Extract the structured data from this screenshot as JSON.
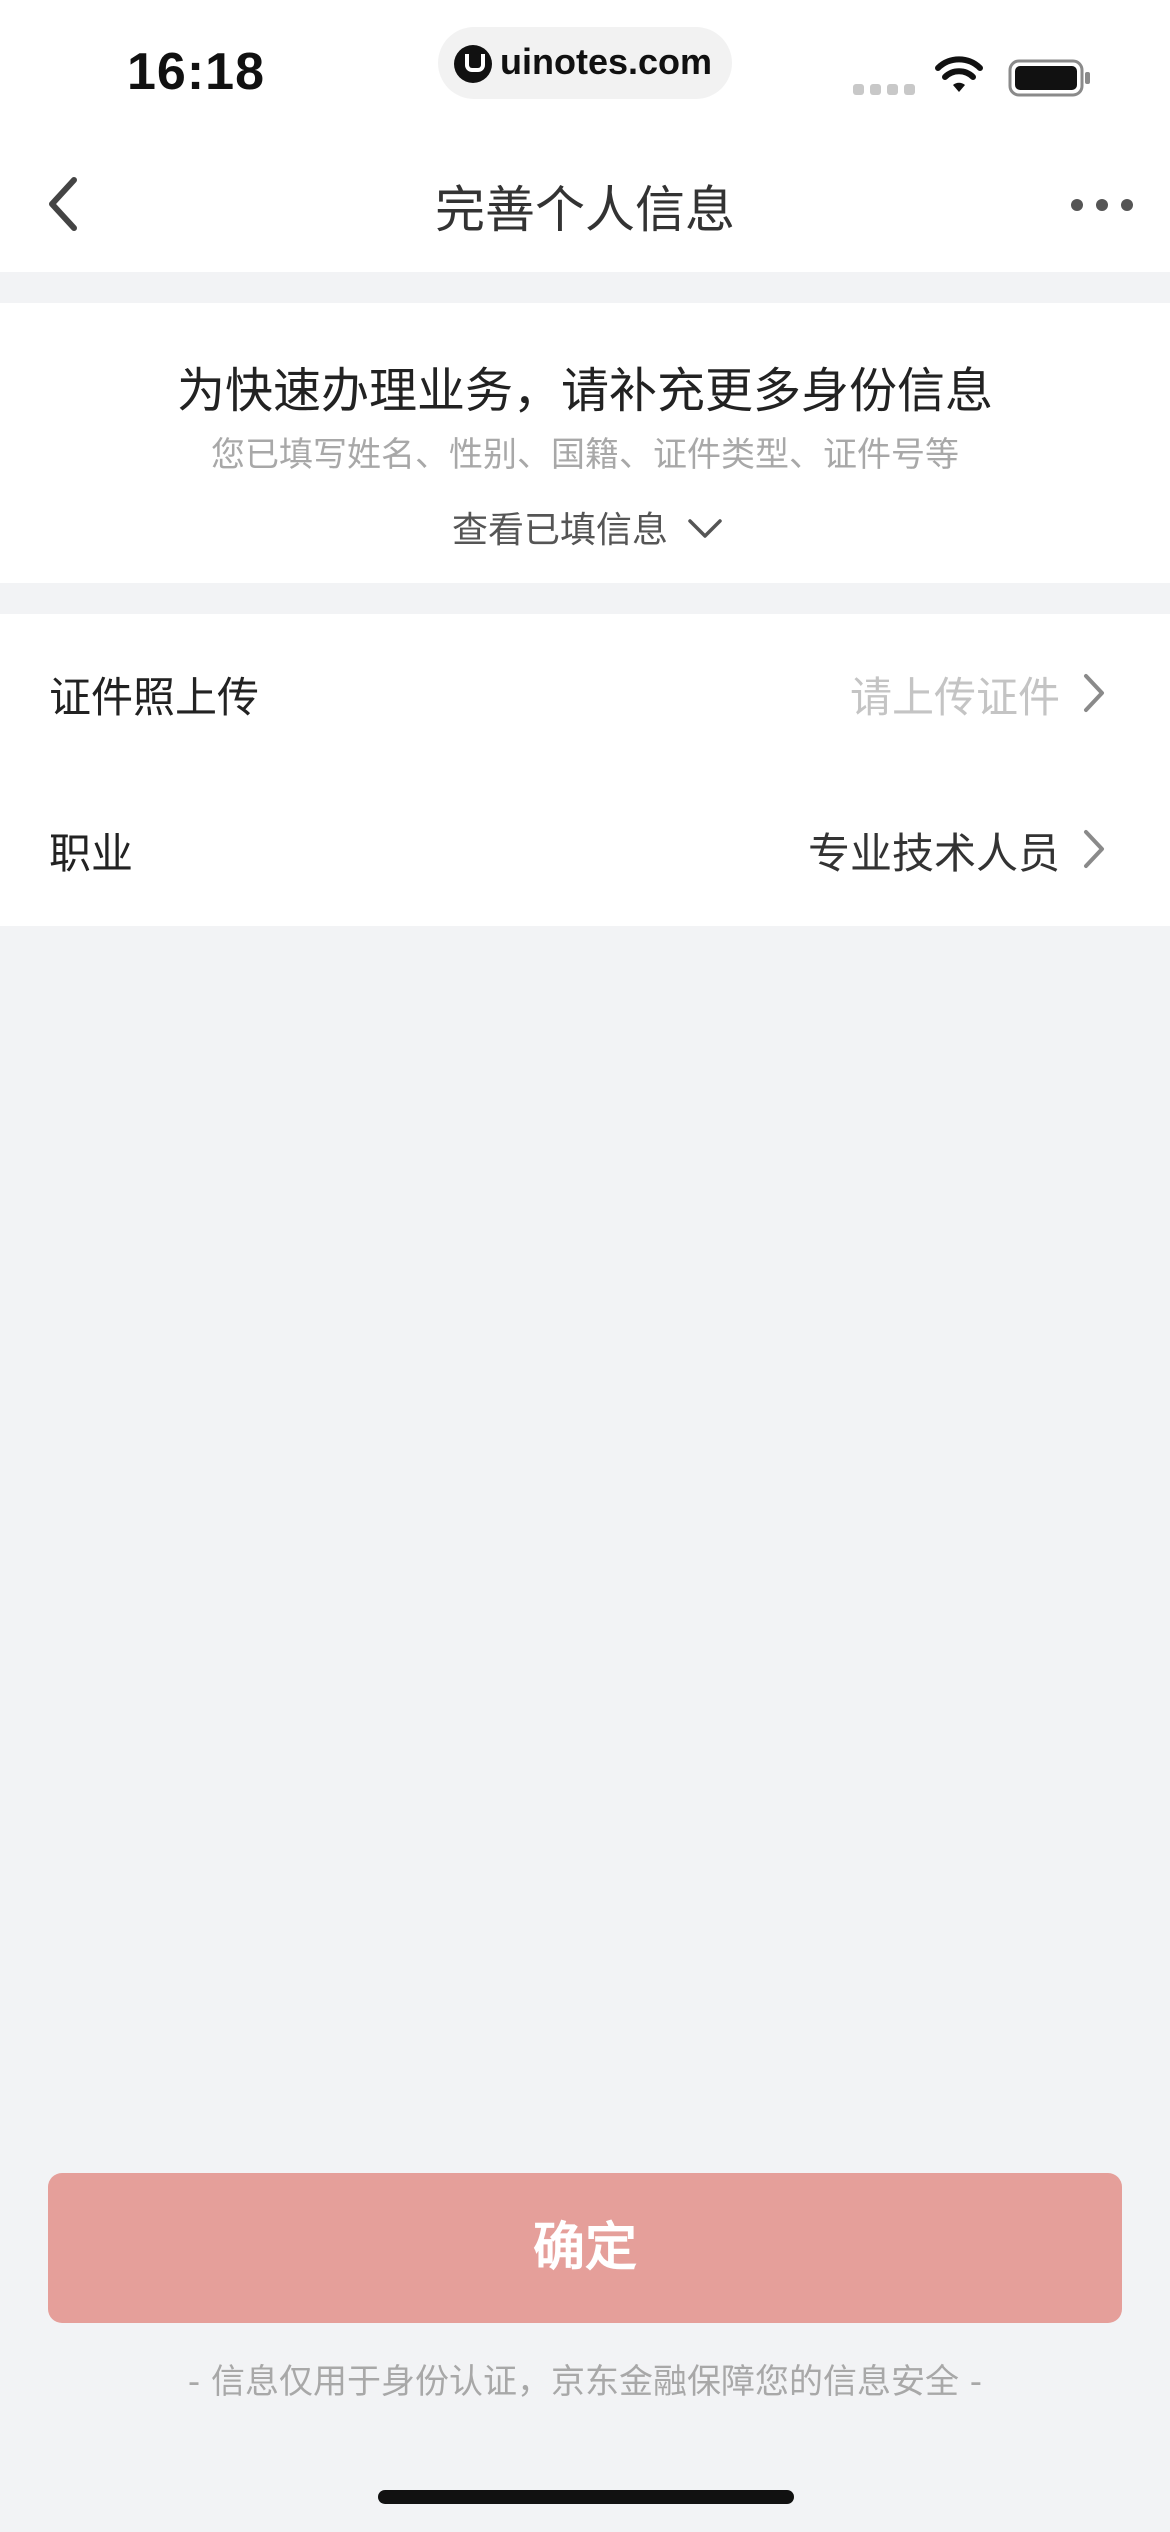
{
  "status_bar": {
    "time": "16:18",
    "url": "uinotes.com"
  },
  "nav": {
    "title": "完善个人信息"
  },
  "intro": {
    "title": "为快速办理业务，请补充更多身份信息",
    "subtitle": "您已填写姓名、性别、国籍、证件类型、证件号等",
    "view_filled_label": "查看已填信息"
  },
  "form": {
    "rows": [
      {
        "label": "证件照上传",
        "value": "请上传证件",
        "is_placeholder": true
      },
      {
        "label": "职业",
        "value": "专业技术人员",
        "is_placeholder": false
      }
    ]
  },
  "actions": {
    "confirm_label": "确定"
  },
  "footer": {
    "note": "- 信息仅用于身份认证，京东金融保障您的信息安全 -"
  },
  "colors": {
    "confirm_bg": "#e59f9a",
    "page_bg": "#f2f3f5",
    "placeholder": "#c4c4c4"
  }
}
